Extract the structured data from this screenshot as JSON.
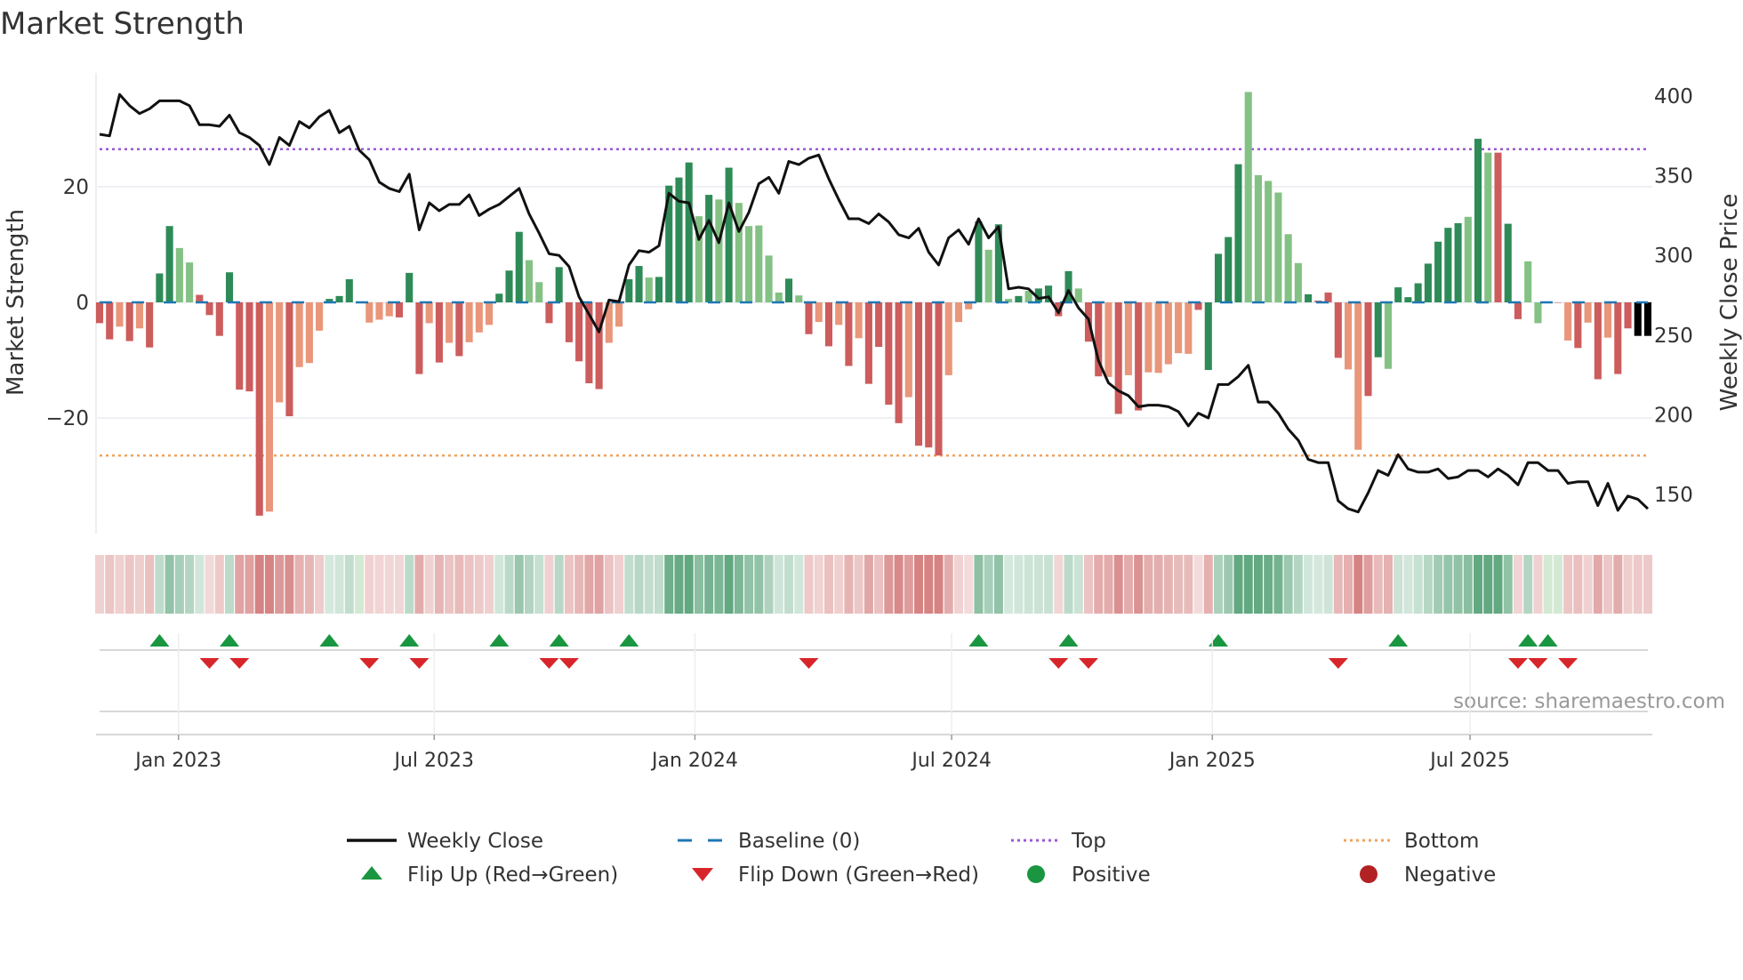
{
  "title": "Market Strength",
  "source": "source: sharemaestro.com",
  "colors": {
    "strong_green": "#2e8b57",
    "weak_green": "#84c184",
    "strong_red": "#cd5c5c",
    "weak_red": "#e9967a",
    "price": "#111111",
    "baseline": "#1f77b4",
    "top": "#9b59d6",
    "bottom": "#f0a35e",
    "flip_up": "#1a9641",
    "flip_down": "#d7262b"
  },
  "chart_data": {
    "type": "bar",
    "title": "Market Strength",
    "ylabel": "Market Strength",
    "y2label": "Weekly Close Price",
    "ylim": [
      -40,
      40
    ],
    "y2lim": [
      123,
      404
    ],
    "yticks": [
      -20,
      0,
      20
    ],
    "y2ticks": [
      150,
      200,
      250,
      300,
      350,
      400
    ],
    "top_level": 26.5,
    "bottom_level": -26.5,
    "x_unit": "week index (weekly, starting Nov 2022)",
    "xticks": [
      {
        "label": "Jan 2023",
        "week": 7.9
      },
      {
        "label": "Jul 2023",
        "week": 33.5
      },
      {
        "label": "Jan 2024",
        "week": 59.6
      },
      {
        "label": "Jul 2024",
        "week": 85.3
      },
      {
        "label": "Jan 2025",
        "week": 111.4
      },
      {
        "label": "Jul 2025",
        "week": 137.2
      }
    ],
    "strength": [
      -3.6,
      -6.4,
      -4.2,
      -6.7,
      -4.5,
      -7.8,
      5,
      13.2,
      9.4,
      6.9,
      1.3,
      -2.2,
      -5.8,
      5.2,
      -15.1,
      -15.4,
      -36.9,
      -36.2,
      -17.3,
      -19.7,
      -11.2,
      -10.5,
      -4.9,
      0.6,
      1.1,
      4,
      0,
      -3.5,
      -3,
      -2.4,
      -2.6,
      5.1,
      -12.4,
      -3.6,
      -10.4,
      -7,
      -9.3,
      -6.9,
      -5.2,
      -3.9,
      1.5,
      5.5,
      12.2,
      7.3,
      3.5,
      -3.6,
      6.1,
      -6.9,
      -10.2,
      -14,
      -15,
      -7,
      -4.2,
      4,
      6.3,
      4.3,
      4.4,
      20.2,
      21.6,
      24.2,
      14.9,
      18.6,
      17.8,
      23.3,
      17.2,
      13.2,
      13.3,
      8.1,
      1.7,
      4.1,
      1.2,
      -5.5,
      -3.4,
      -7.6,
      -3.9,
      -11,
      -6.2,
      -14.1,
      -7.7,
      -17.7,
      -20.9,
      -16.4,
      -24.8,
      -25.1,
      -26.5,
      -12.6,
      -3.4,
      -1.2,
      14,
      9.1,
      13.5,
      0.6,
      1.1,
      2,
      2.4,
      2.9,
      -2.4,
      5.4,
      2.4,
      -6.8,
      -12.8,
      -12.9,
      -19.3,
      -12.6,
      -18.7,
      -12.1,
      -12.2,
      -10.7,
      -8.8,
      -8.9,
      -1.3,
      -11.7,
      8.4,
      11.3,
      23.9,
      36.4,
      22,
      21,
      19,
      11.8,
      6.8,
      1.4,
      0.3,
      1.7,
      -9.6,
      -11.6,
      -25.5,
      -16.2,
      -9.5,
      -11.5,
      2.6,
      0.9,
      3.3,
      6.7,
      10.5,
      12.9,
      13.7,
      14.8,
      28.3,
      25.9,
      25.9,
      13.6,
      -2.9,
      7.1,
      -3.6,
      0,
      0,
      -6.6,
      -7.9,
      -3.5,
      -13.3,
      -6.1,
      -12.4,
      -4.5,
      -5.8,
      -5.8
    ],
    "strength_shade": "RRrRrRGGggRRRGRRRrrRrrrGGG0rrrRGRrRrRrrrGGGggRGRRRRrrGGgGGGGgGgGgggggGgRrRrRrRRRRrRRRrrrGgGgGgGGRGgRRrRrRrrrrrRGGGGggggggGRRRrrRGgGGGGGGGgGgRGR00RRrRrRrRR",
    "price": [
      376,
      375,
      401,
      394,
      389,
      392,
      397,
      397,
      397,
      394,
      382,
      382,
      381,
      388,
      377,
      374,
      369,
      357,
      374,
      369,
      384,
      380,
      387,
      391,
      377,
      381,
      366,
      360,
      346,
      342,
      340,
      351,
      316,
      333,
      328,
      332,
      332,
      338,
      325,
      329,
      332,
      337,
      342,
      326,
      314,
      301,
      300,
      293,
      274,
      263,
      252,
      272,
      271,
      294,
      303,
      302,
      306,
      339,
      334,
      333,
      310,
      322,
      308,
      333,
      315,
      327,
      345,
      349,
      339,
      359,
      357,
      361,
      363,
      348,
      335,
      323,
      323,
      320,
      326,
      321,
      313,
      311,
      317,
      302,
      294,
      311,
      316,
      307,
      323,
      311,
      318,
      279,
      280,
      279,
      273,
      274,
      264,
      278,
      267,
      260,
      234,
      220,
      215,
      212,
      205,
      206,
      206,
      205,
      202,
      193,
      201,
      198,
      219,
      219,
      224,
      231,
      208,
      208,
      201,
      191,
      184,
      172,
      170,
      170,
      146,
      141,
      139,
      151,
      165,
      162,
      175,
      166,
      164,
      164,
      166,
      160,
      161,
      165,
      165,
      161,
      166,
      162,
      156,
      170,
      170,
      165,
      165,
      157,
      158,
      158,
      143,
      157,
      140,
      149,
      147,
      141
    ],
    "flip_up_weeks": [
      6,
      13,
      23,
      31,
      40,
      46,
      53,
      88,
      97,
      112,
      130,
      143,
      145
    ],
    "flip_down_weeks": [
      11,
      14,
      27,
      32,
      45,
      47,
      71,
      96,
      99,
      124,
      142,
      144,
      147
    ],
    "legend": [
      {
        "label": "Weekly Close",
        "kind": "line"
      },
      {
        "label": "Baseline (0)",
        "kind": "dashed"
      },
      {
        "label": "Top",
        "kind": "dotted-top"
      },
      {
        "label": "Bottom",
        "kind": "dotted-bottom"
      },
      {
        "label": "Flip Up (Red→Green)",
        "kind": "tri-up"
      },
      {
        "label": "Flip Down (Green→Red)",
        "kind": "tri-down"
      },
      {
        "label": "Positive",
        "kind": "dot-pos"
      },
      {
        "label": "Negative",
        "kind": "dot-neg"
      }
    ],
    "legend_position": "bottom"
  }
}
